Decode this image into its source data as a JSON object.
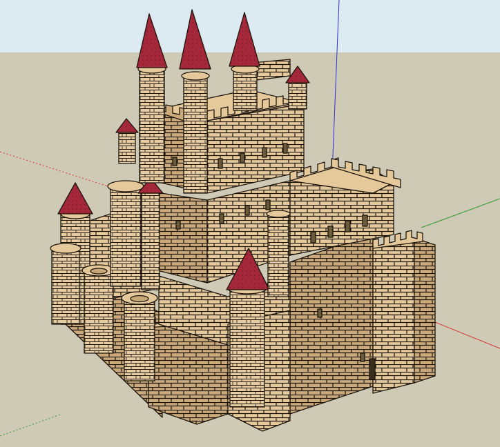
{
  "viewport": {
    "kind": "3d-modeling-viewport",
    "subject": "medieval-castle-model",
    "render_style": "sketchy-edges-with-brick-texture"
  },
  "colors": {
    "sky": "#dcebf1",
    "ground": "#cfcab6",
    "stone": "#e5c99b",
    "stone_shadow": "#c9a878",
    "mortar_line": "#1a140c",
    "roof": "#a5283a",
    "roof_shadow": "#7e1a2a",
    "window": "#6b5a3a",
    "axis_red": "#d63030",
    "axis_green": "#2f9a2f",
    "axis_blue": "#2d2dd6"
  },
  "axes": [
    "red-axis",
    "green-axis",
    "blue-axis"
  ]
}
